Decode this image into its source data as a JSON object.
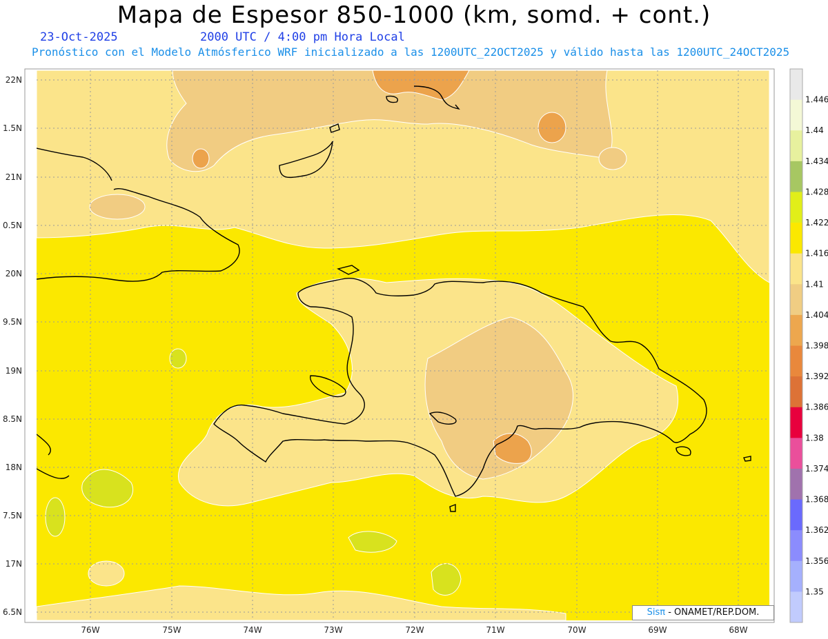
{
  "header": {
    "title": "Mapa de Espesor 850-1000 (km, somd. + cont.)",
    "date": "23-Oct-2025",
    "time": "2000 UTC / 4:00 pm Hora Local",
    "subtitle": "Pronóstico con el Modelo Atmósferico WRF inicializado a las 1200UTC_22OCT2025 y válido hasta las  1200UTC_24OCT2025"
  },
  "credit": {
    "brand": "Sisπ",
    "text": "- ONAMET/REP.DOM."
  },
  "colors": {
    "yellow": "#fbe800",
    "light_yellow": "#fbe48a",
    "tan": "#f1cc82",
    "orange": "#eca34c",
    "dark_orange": "#e6883a",
    "green_yellow": "#d8e21e",
    "green": "#a9c85e",
    "coast": "#000000"
  },
  "chart_data": {
    "type": "heatmap",
    "title": "Mapa de Espesor 850-1000 (km, somd. + cont.)",
    "x_ticks": [
      "76W",
      "75W",
      "74W",
      "73W",
      "72W",
      "71W",
      "70W",
      "69W",
      "68W"
    ],
    "y_ticks": [
      "22N",
      "1.5N",
      "21N",
      "0.5N",
      "20N",
      "9.5N",
      "19N",
      "8.5N",
      "18N",
      "7.5N",
      "17N",
      "6.5N"
    ],
    "colorbar": {
      "labels": [
        "1.446",
        "1.44",
        "1.434",
        "1.428",
        "1.422",
        "1.416",
        "1.41",
        "1.404",
        "1.398",
        "1.392",
        "1.386",
        "1.38",
        "1.374",
        "1.368",
        "1.362",
        "1.356",
        "1.35"
      ],
      "colors": [
        "#e9e9e9",
        "#f4f8d6",
        "#e7f19e",
        "#a7c762",
        "#e1ee19",
        "#fbe800",
        "#fbe48a",
        "#f0cd83",
        "#eda74e",
        "#e9883c",
        "#dd7236",
        "#e8003d",
        "#ea4f9b",
        "#a072ad",
        "#6a6afd",
        "#8b8cfd",
        "#a5b0fd",
        "#c1cbfd"
      ]
    },
    "grid": true
  }
}
